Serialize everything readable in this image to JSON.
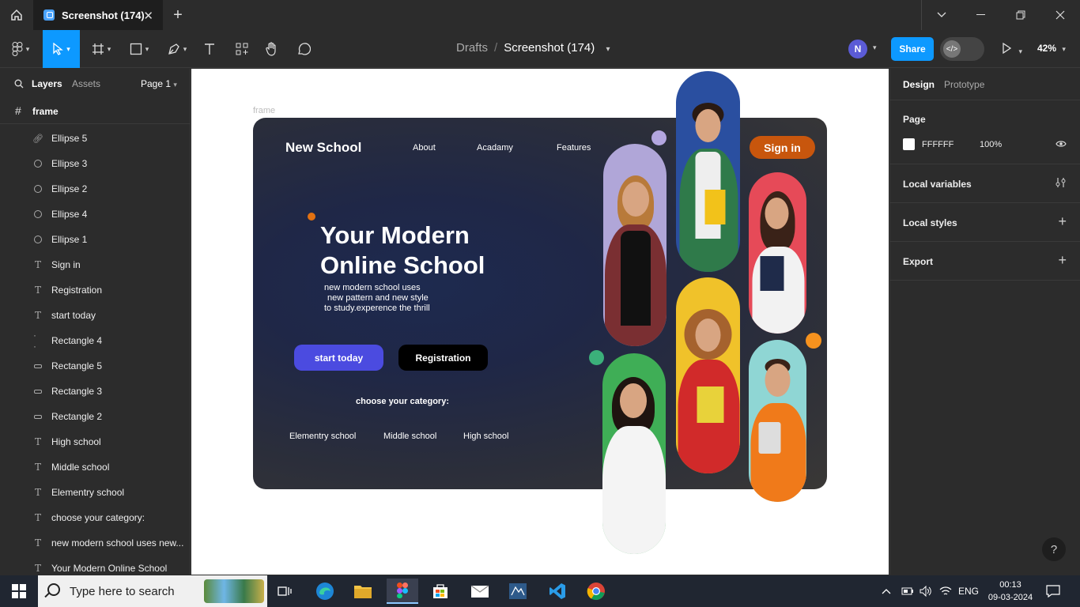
{
  "titlebar": {
    "tab_title": "Screenshot (174)",
    "tab_close": "✕",
    "new_tab": "+"
  },
  "toolbar": {
    "breadcrumb_parent": "Drafts",
    "breadcrumb_file": "Screenshot (174)",
    "avatar_initial": "N",
    "share_label": "Share",
    "zoom_label": "42%",
    "active_tool": "move"
  },
  "left_panel": {
    "tab_layers": "Layers",
    "tab_assets": "Assets",
    "page_selector": "Page 1",
    "frame_name": "frame",
    "layers": [
      {
        "name": "Ellipse 5",
        "icon": "ellipse-link-icon"
      },
      {
        "name": "Ellipse 3",
        "icon": "ellipse-icon"
      },
      {
        "name": "Ellipse 2",
        "icon": "ellipse-icon"
      },
      {
        "name": "Ellipse 4",
        "icon": "ellipse-icon"
      },
      {
        "name": "Ellipse 1",
        "icon": "ellipse-icon"
      },
      {
        "name": "Sign in",
        "icon": "text-icon"
      },
      {
        "name": "Registration",
        "icon": "text-icon"
      },
      {
        "name": "start today",
        "icon": "text-icon"
      },
      {
        "name": "Rectangle 4",
        "icon": "dashed-rect-icon"
      },
      {
        "name": "Rectangle 5",
        "icon": "rect-icon"
      },
      {
        "name": "Rectangle 3",
        "icon": "rect-icon"
      },
      {
        "name": "Rectangle 2",
        "icon": "rect-icon"
      },
      {
        "name": "High school",
        "icon": "text-icon"
      },
      {
        "name": "Middle school",
        "icon": "text-icon"
      },
      {
        "name": "Elementry school",
        "icon": "text-icon"
      },
      {
        "name": "choose your category:",
        "icon": "text-icon"
      },
      {
        "name": "new modern school uses new...",
        "icon": "text-icon"
      },
      {
        "name": "Your Modern Online School",
        "icon": "text-icon"
      }
    ]
  },
  "canvas": {
    "frame_label": "frame",
    "design": {
      "brand": "New School",
      "nav": [
        "About",
        "Acadamy",
        "Features"
      ],
      "sign_in": "Sign in",
      "hero_line1": "Your Modern",
      "hero_line2": "Online School",
      "sub_line1": "new modern school uses",
      "sub_line2": "new pattern and new style",
      "sub_line3": "to study.experence the thrill",
      "btn_start": "start today",
      "btn_register": "Registration",
      "choose": "choose your category:",
      "categories": [
        "Elementry school",
        "Middle school",
        "High school"
      ],
      "colors": {
        "accent_purple": "#4b4be0",
        "sign_in_orange": "#c8560d",
        "dot_orange": "#e27111",
        "dot_lavender": "#b3a6e0",
        "dot_green": "#3bb07a",
        "dot_orange_big": "#f6921e"
      }
    }
  },
  "right_panel": {
    "tab_design": "Design",
    "tab_prototype": "Prototype",
    "page_title": "Page",
    "page_color": "FFFFFF",
    "page_opacity": "100%",
    "local_variables": "Local variables",
    "local_styles": "Local styles",
    "export": "Export",
    "help": "?"
  },
  "taskbar": {
    "search_placeholder": "Type here to search",
    "language": "ENG",
    "time": "00:13",
    "date": "09-03-2024"
  }
}
